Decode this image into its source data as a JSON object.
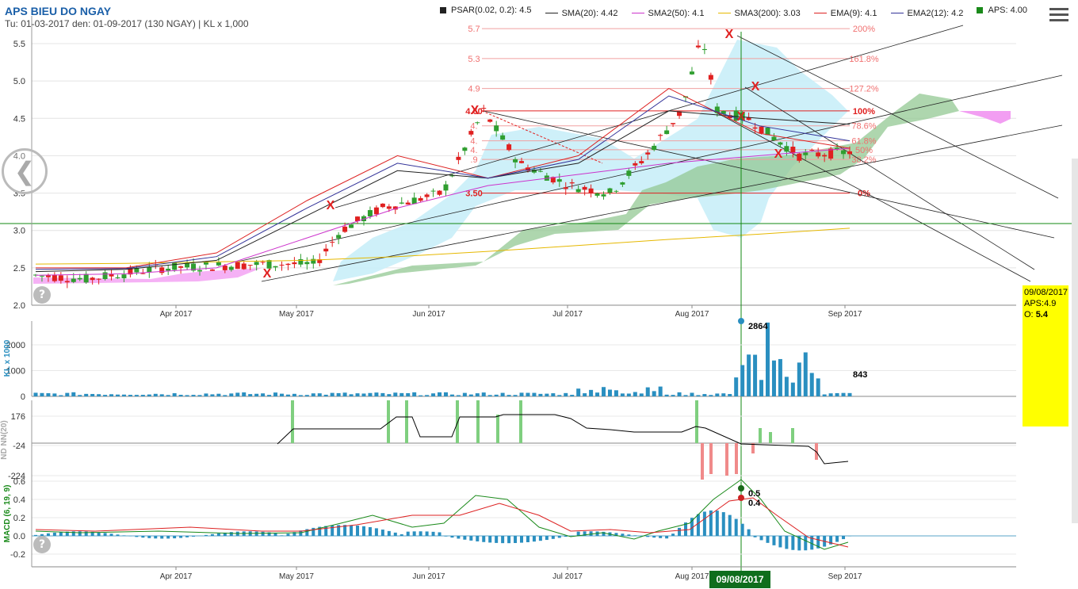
{
  "header": {
    "title": "APS BIEU DO NGAY",
    "subtitle": "Tu: 01-03-2017 den: 01-09-2017 (130 NGAY) | KL x 1,000"
  },
  "legend": [
    {
      "label": "PSAR(0.02, 0.2): 4.5",
      "color": "#222222",
      "kind": "square"
    },
    {
      "label": "SMA(20): 4.42",
      "color": "#222222",
      "kind": "line"
    },
    {
      "label": "SMA2(50): 4.1",
      "color": "#cc33cc",
      "kind": "line"
    },
    {
      "label": "SMA3(200): 3.03",
      "color": "#e6b800",
      "kind": "line"
    },
    {
      "label": "EMA(9): 4.1",
      "color": "#dd2222",
      "kind": "line"
    },
    {
      "label": "EMA2(12): 4.2",
      "color": "#333399",
      "kind": "line"
    },
    {
      "label": "APS: 4.00",
      "color": "#1a8a1a",
      "kind": "square"
    }
  ],
  "colors": {
    "up": "#2f9e2f",
    "down": "#e02020",
    "volume": "#2a8fc0",
    "cloud": "#bfe9f6",
    "kumo": "#93c893",
    "crosshair": "#118811"
  },
  "icons": {
    "nav": "chevron-left-icon",
    "help": "question-icon",
    "menu": "hamburger-menu-icon"
  },
  "tooltip": {
    "date": "09/08/2017",
    "price": "APS:4.9",
    "open_label": "O:",
    "open_value": "5.4"
  },
  "crosshair_date": "09/08/2017",
  "chart_data": [
    {
      "type": "candlestick",
      "name": "price",
      "yticks": [
        "2.0",
        "2.5",
        "3.0",
        "3.5",
        "4.0",
        "4.5",
        "5.0",
        "5.5"
      ],
      "ylim": [
        2.0,
        5.8
      ],
      "xticks": [
        "Apr 2017",
        "May 2017",
        "Jun 2017",
        "Jul 2017",
        "Aug 2017",
        "Sep 2017"
      ],
      "fibonacci": [
        {
          "label": "5.7",
          "pct": "200%",
          "value": 5.7
        },
        {
          "label": "5.3",
          "pct": "161.8%",
          "value": 5.3
        },
        {
          "label": "4.9",
          "pct": "127.2%",
          "value": 4.9
        },
        {
          "label": "4.60",
          "pct": "100%",
          "value": 4.6
        },
        {
          "label": "4.",
          "pct": "78.6%",
          "value": 4.4
        },
        {
          "label": "4.",
          "pct": "61.8%",
          "value": 4.2
        },
        {
          "label": "4.",
          "pct": "50%",
          "value": 4.08
        },
        {
          "label": ".9",
          "pct": "38.2%",
          "value": 3.95
        },
        {
          "label": "3.50",
          "pct": "0%",
          "value": 3.5
        }
      ],
      "series": [
        {
          "name": "SMA3(200)",
          "values": [
            2.55,
            2.56,
            2.58,
            2.6,
            2.65,
            2.72,
            2.8,
            2.88,
            2.95,
            3.03
          ]
        },
        {
          "name": "SMA2(50)",
          "values": [
            2.4,
            2.42,
            2.5,
            2.9,
            3.3,
            3.6,
            3.75,
            3.9,
            4.0,
            4.1
          ]
        },
        {
          "name": "SMA(20)",
          "values": [
            2.45,
            2.48,
            2.6,
            3.2,
            3.8,
            3.7,
            3.9,
            4.6,
            4.5,
            4.42
          ]
        },
        {
          "name": "EMA(9)",
          "values": [
            2.5,
            2.5,
            2.7,
            3.4,
            4.0,
            3.7,
            4.0,
            4.9,
            4.3,
            4.1
          ]
        },
        {
          "name": "EMA2(12)",
          "values": [
            2.48,
            2.49,
            2.65,
            3.3,
            3.9,
            3.7,
            3.95,
            4.8,
            4.4,
            4.2
          ]
        }
      ]
    },
    {
      "type": "bar",
      "name": "volume",
      "ylabel": "KL x 1000",
      "yticks": [
        "0",
        "1000",
        "2000"
      ],
      "annotations": [
        "2864",
        "843"
      ]
    },
    {
      "type": "bar",
      "name": "foreign",
      "ylabel": "ND NN(20)",
      "yticks": [
        "176",
        "-24",
        "-224"
      ]
    },
    {
      "type": "line",
      "name": "macd",
      "ylabel": "MACD (6, 19, 9)",
      "yticks": [
        "0.6",
        "0.4",
        "0.2",
        "0.0",
        "-0.2"
      ],
      "annotations": [
        "0.5",
        "0.4"
      ],
      "xticks": [
        "Apr 2017",
        "May 2017",
        "Jun 2017",
        "Jul 2017",
        "Aug 2017",
        "Sep 2017"
      ]
    }
  ]
}
